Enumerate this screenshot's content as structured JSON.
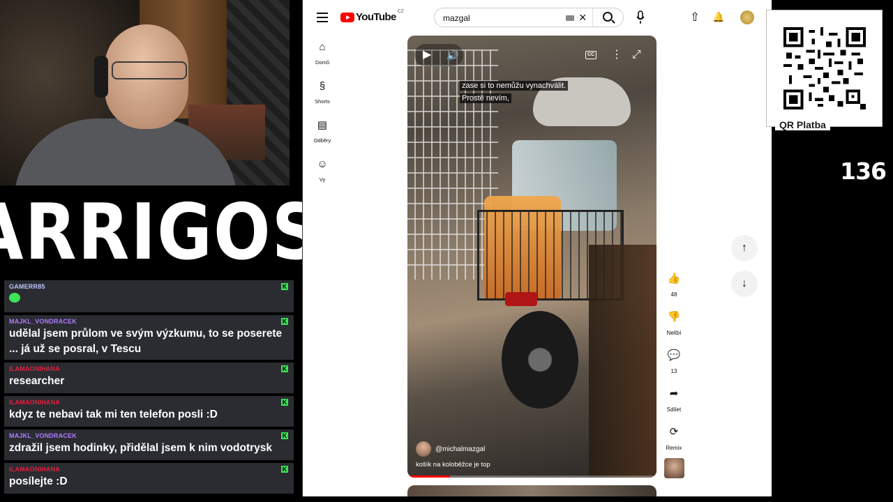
{
  "logo": {
    "text": "ARRIGOS"
  },
  "chat": {
    "messages": [
      {
        "user": "GAMERR85",
        "user_color": "#b8c6ff",
        "text": "",
        "has_emote": true
      },
      {
        "user": "MAJKL_VONDRACEK",
        "user_color": "#b07cff",
        "text": "udělal jsem průlom ve svým výzkumu, to se poserete ... já už se posral, v Tescu"
      },
      {
        "user": "ILAMAONIHANA",
        "user_color": "#e81e3d",
        "text": "researcher"
      },
      {
        "user": "ILAMAONIHANA",
        "user_color": "#e81e3d",
        "text": "kdyz te nebavi tak mi ten telefon posli :D"
      },
      {
        "user": "MAJKL_VONDRACEK",
        "user_color": "#b07cff",
        "text": "zdražil jsem hodinky, přidělal jsem k nim vodotrysk"
      },
      {
        "user": "ILAMAONIHANA",
        "user_color": "#e81e3d",
        "text": "posílejte :D"
      }
    ],
    "badge_icon": "kick-icon",
    "badge_glyph": "K"
  },
  "youtube": {
    "brand": "YouTube",
    "country": "CZ",
    "search": {
      "value": "mazgal",
      "clear_glyph": "×"
    },
    "nav": [
      {
        "label": "Domů",
        "icon": "home-icon",
        "glyph": "⌂"
      },
      {
        "label": "Shorts",
        "icon": "shorts-icon",
        "glyph": "§"
      },
      {
        "label": "Odběry",
        "icon": "subscriptions-icon",
        "glyph": "▤"
      },
      {
        "label": "Vy",
        "icon": "you-icon",
        "glyph": "☺"
      }
    ],
    "header_icons": {
      "upload": "⇧",
      "notifications": "🔔"
    },
    "video": {
      "subtitle_line1": "zase si to nemůžu vynachválit.",
      "subtitle_line2": "Prostě nevím,",
      "channel": "@michalmazgal",
      "caption": "košík na koloběžce je top",
      "progress": 0.17,
      "cc_label": "CC",
      "glyphs": {
        "play": "▶",
        "volume": "🔊",
        "more": "⋮",
        "fullscreen": "⤢"
      }
    },
    "actions": [
      {
        "icon": "like-icon",
        "glyph": "👍",
        "label": "48"
      },
      {
        "icon": "dislike-icon",
        "glyph": "👎",
        "label": "Nelíbí"
      },
      {
        "icon": "comment-icon",
        "glyph": "💬",
        "label": "13"
      },
      {
        "icon": "share-icon",
        "glyph": "➦",
        "label": "Sdílet"
      },
      {
        "icon": "remix-icon",
        "glyph": "⟳",
        "label": "Remix"
      }
    ],
    "arrows": {
      "up": "↑",
      "down": "↓"
    }
  },
  "qr": {
    "label": "QR Platba"
  },
  "counter": {
    "value": "136"
  }
}
